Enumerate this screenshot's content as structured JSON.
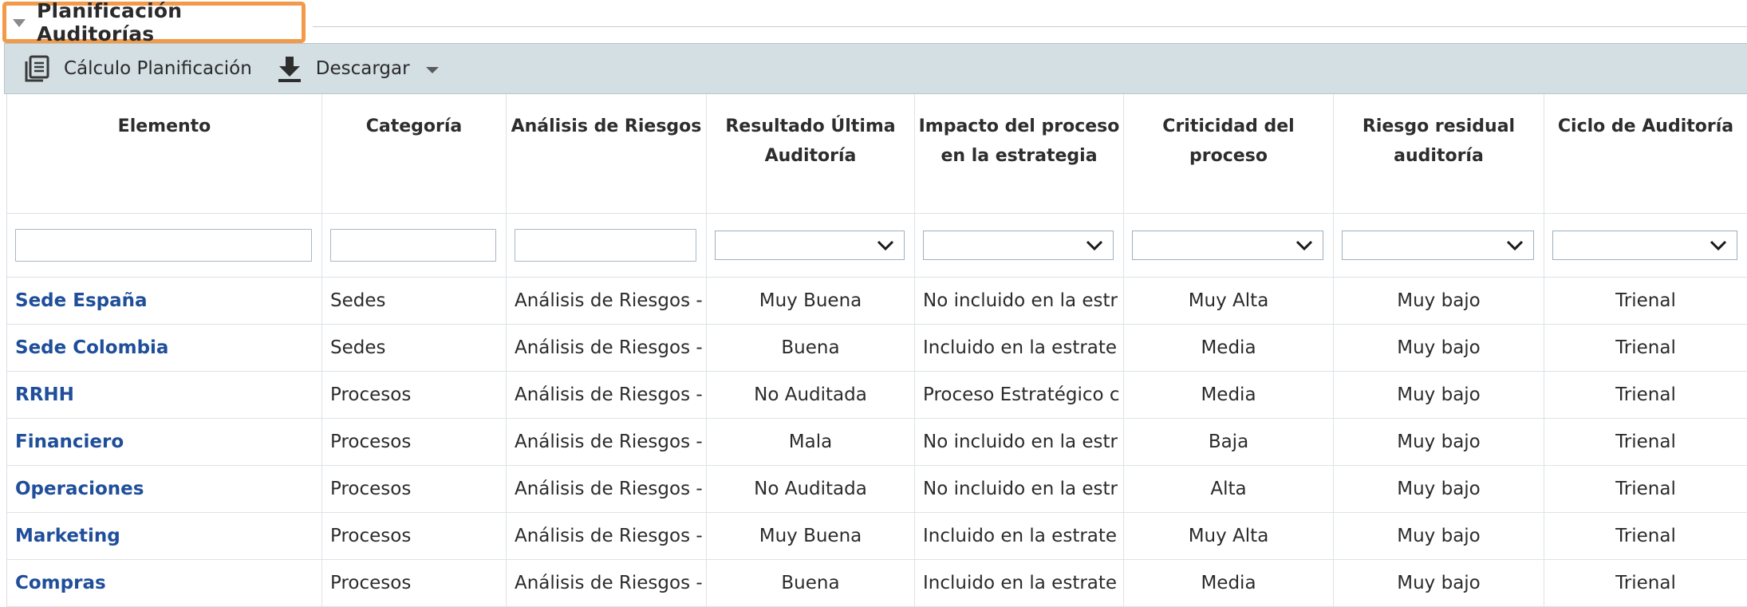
{
  "section": {
    "title": "Planificación Auditorías",
    "collapse_icon": "triangle-down-icon"
  },
  "toolbar": {
    "calc_label": "Cálculo Planificación",
    "calc_icon": "document-list-icon",
    "download_label": "Descargar",
    "download_icon": "download-arrow-icon"
  },
  "colors": {
    "accent_border": "#f39a4a",
    "toolbar_bg": "#d4dfe4",
    "link": "#1f4e9a"
  },
  "table": {
    "columns": [
      {
        "label": "Elemento",
        "filter": "text"
      },
      {
        "label": "Categoría",
        "filter": "text"
      },
      {
        "label": "Análisis de Riesgos",
        "filter": "text"
      },
      {
        "label": "Resultado Última Auditoría",
        "filter": "select"
      },
      {
        "label": "Impacto del proceso en la estrategia",
        "filter": "select"
      },
      {
        "label": "Criticidad del proceso",
        "filter": "select"
      },
      {
        "label": "Riesgo residual auditoría",
        "filter": "select"
      },
      {
        "label": "Ciclo de Auditoría",
        "filter": "select"
      }
    ],
    "rows": [
      [
        "Sede España",
        "Sedes",
        "Análisis de Riesgos -",
        "Muy Buena",
        "No incluido en la estr",
        "Muy Alta",
        "Muy bajo",
        "Trienal"
      ],
      [
        "Sede Colombia",
        "Sedes",
        "Análisis de Riesgos -",
        "Buena",
        "Incluido en la estrate",
        "Media",
        "Muy bajo",
        "Trienal"
      ],
      [
        "RRHH",
        "Procesos",
        "Análisis de Riesgos -",
        "No Auditada",
        "Proceso Estratégico c",
        "Media",
        "Muy bajo",
        "Trienal"
      ],
      [
        "Financiero",
        "Procesos",
        "Análisis de Riesgos -",
        "Mala",
        "No incluido en la estr",
        "Baja",
        "Muy bajo",
        "Trienal"
      ],
      [
        "Operaciones",
        "Procesos",
        "Análisis de Riesgos -",
        "No Auditada",
        "No incluido en la estr",
        "Alta",
        "Muy bajo",
        "Trienal"
      ],
      [
        "Marketing",
        "Procesos",
        "Análisis de Riesgos -",
        "Muy Buena",
        "Incluido en la estrate",
        "Muy Alta",
        "Muy bajo",
        "Trienal"
      ],
      [
        "Compras",
        "Procesos",
        "Análisis de Riesgos -",
        "Buena",
        "Incluido en la estrate",
        "Media",
        "Muy bajo",
        "Trienal"
      ]
    ]
  }
}
